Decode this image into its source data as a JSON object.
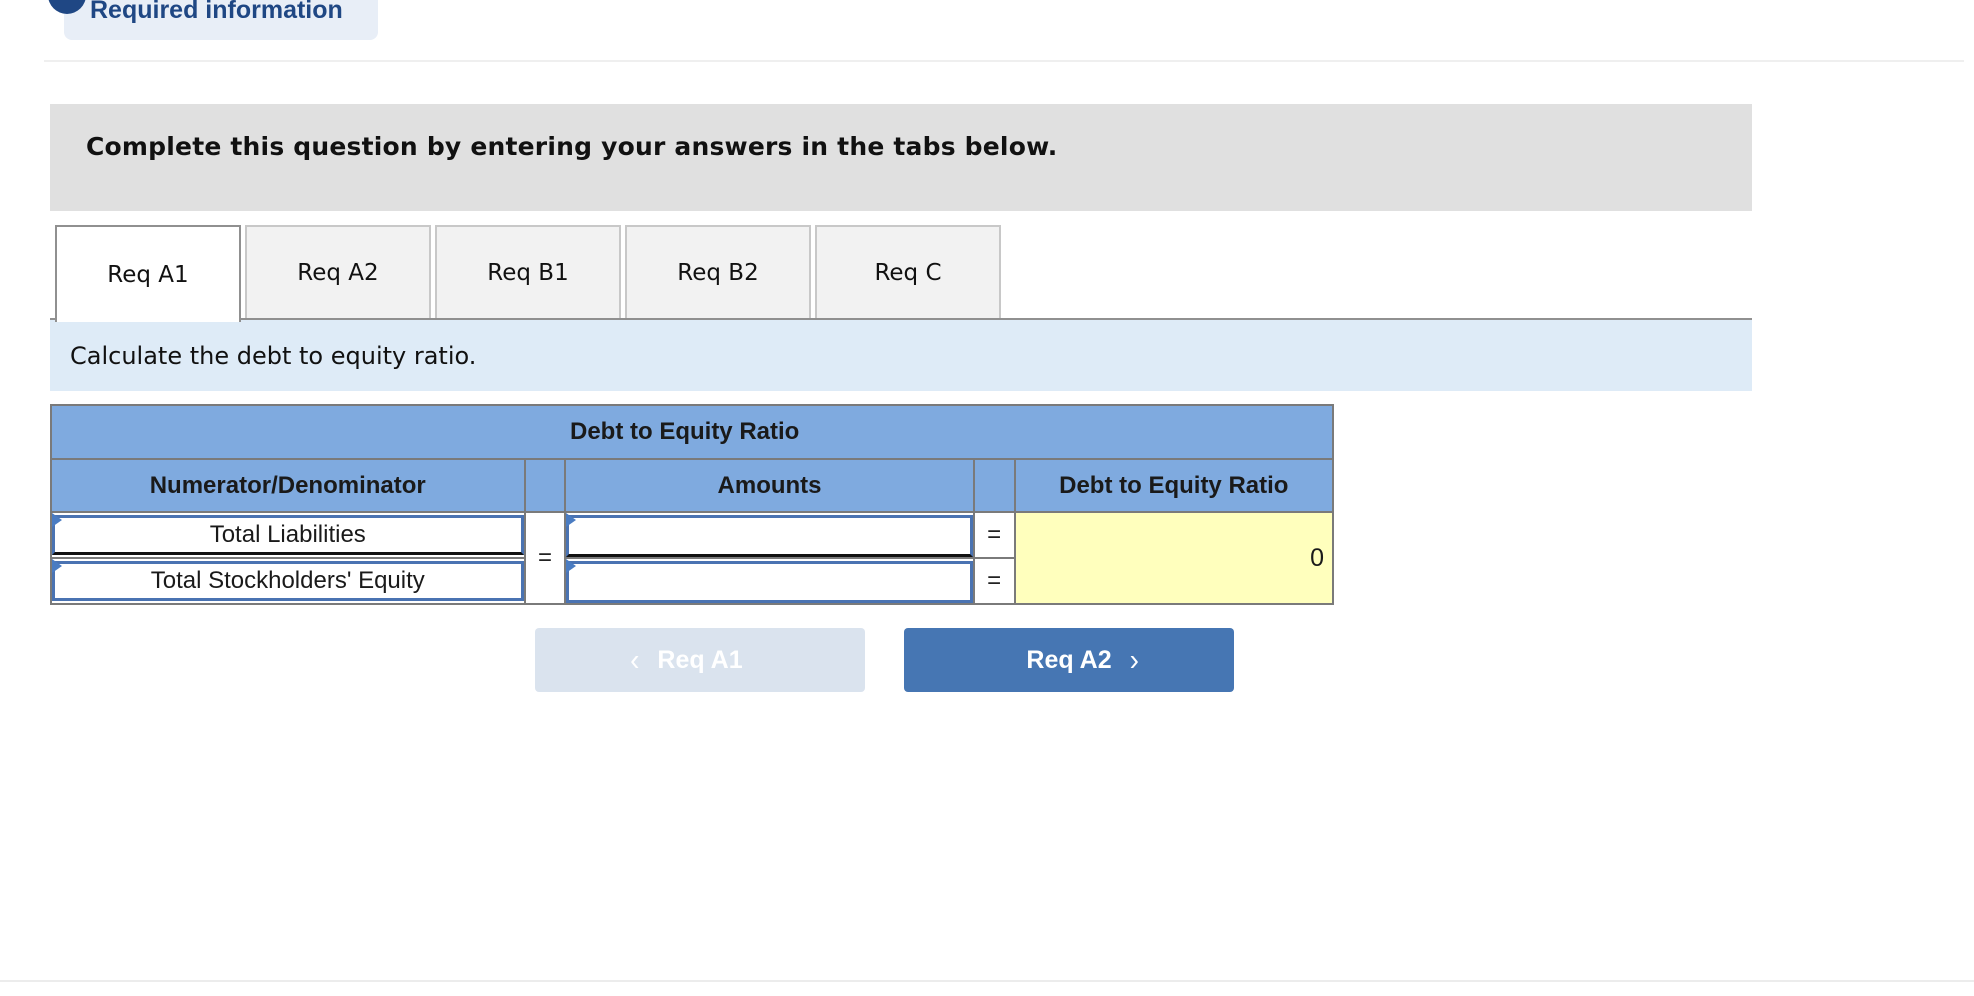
{
  "header": {
    "required_info_label": "Required information"
  },
  "instructions": {
    "text": "Complete this question by entering your answers in the tabs below."
  },
  "tabs": [
    {
      "label": "Req A1",
      "active": true
    },
    {
      "label": "Req A2",
      "active": false
    },
    {
      "label": "Req B1",
      "active": false
    },
    {
      "label": "Req B2",
      "active": false
    },
    {
      "label": "Req C",
      "active": false
    }
  ],
  "prompt": {
    "text": "Calculate the debt to equity ratio."
  },
  "table": {
    "title": "Debt to Equity Ratio",
    "columns": [
      "Numerator/Denominator",
      "",
      "Amounts",
      "",
      "Debt to Equity Ratio"
    ],
    "rows": [
      {
        "label": "Total Liabilities",
        "amount_value": "",
        "equals": "="
      },
      {
        "label": "Total Stockholders' Equity",
        "amount_value": "",
        "equals": "="
      }
    ],
    "left_equals": "=",
    "result_value": "0"
  },
  "navigation": {
    "prev_label": "Req A1",
    "next_label": "Req A2",
    "prev_icon": "chevron-left-icon",
    "next_icon": "chevron-right-icon",
    "prev_glyph": "‹",
    "next_glyph": "›"
  },
  "colors": {
    "accent_blue": "#4676b3",
    "header_blue": "#7faadf",
    "result_yellow": "#ffffbd",
    "prompt_bg": "#deebf7",
    "instructions_bg": "#e0e0e0",
    "required_text": "#1f4784"
  }
}
